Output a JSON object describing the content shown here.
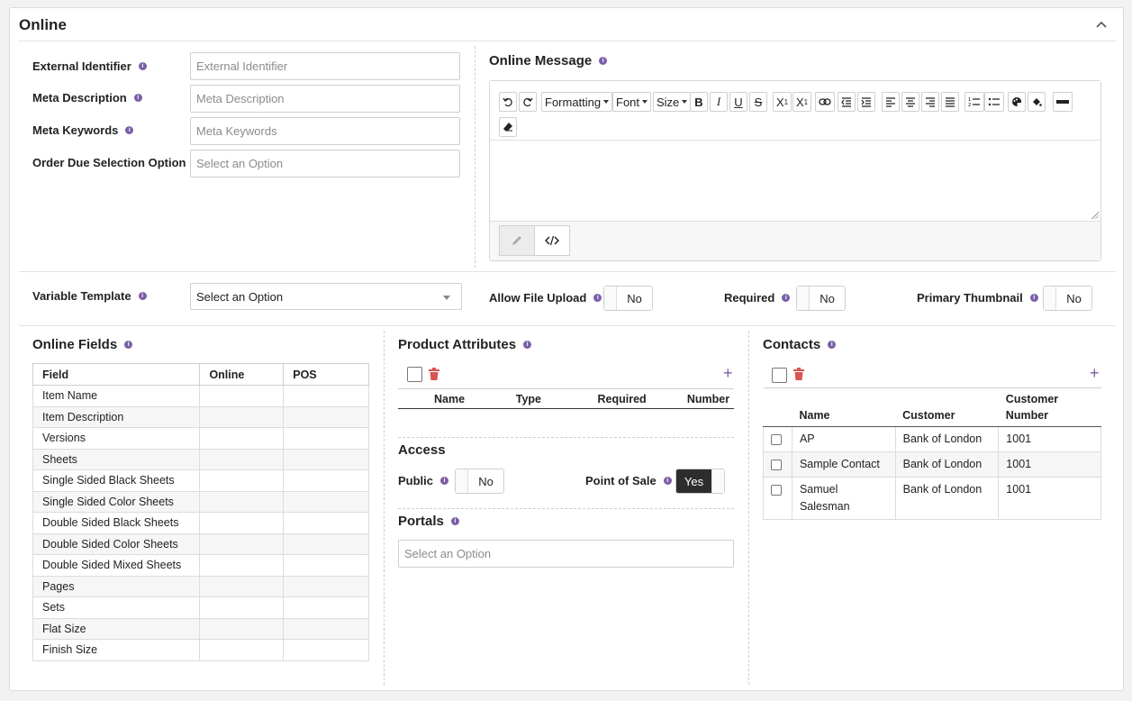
{
  "panel": {
    "title": "Online"
  },
  "general": {
    "external_identifier": {
      "label": "External Identifier",
      "placeholder": "External Identifier"
    },
    "meta_description": {
      "label": "Meta Description",
      "placeholder": "Meta Description"
    },
    "meta_keywords": {
      "label": "Meta Keywords",
      "placeholder": "Meta Keywords"
    },
    "order_due": {
      "label": "Order Due Selection Option",
      "placeholder": "Select an Option"
    }
  },
  "online_message": {
    "label": "Online Message",
    "toolbar": {
      "formatting": "Formatting",
      "font": "Font",
      "size": "Size"
    }
  },
  "options_row": {
    "variable_template": {
      "label": "Variable Template",
      "value": "Select an Option"
    },
    "allow_file_upload": {
      "label": "Allow File Upload",
      "value": "No"
    },
    "required": {
      "label": "Required",
      "value": "No"
    },
    "primary_thumbnail": {
      "label": "Primary Thumbnail",
      "value": "No"
    }
  },
  "online_fields": {
    "title": "Online Fields",
    "columns": [
      "Field",
      "Online",
      "POS"
    ],
    "rows": [
      "Item Name",
      "Item Description",
      "Versions",
      "Sheets",
      "Single Sided Black Sheets",
      "Single Sided Color Sheets",
      "Double Sided Black Sheets",
      "Double Sided Color Sheets",
      "Double Sided Mixed Sheets",
      "Pages",
      "Sets",
      "Flat Size",
      "Finish Size"
    ]
  },
  "product_attributes": {
    "title": "Product Attributes",
    "columns": [
      "Name",
      "Type",
      "Required",
      "Number"
    ]
  },
  "access": {
    "title": "Access",
    "public": {
      "label": "Public",
      "value": "No"
    },
    "point_of_sale": {
      "label": "Point of Sale",
      "value": "Yes"
    }
  },
  "portals": {
    "title": "Portals",
    "placeholder": "Select an Option"
  },
  "contacts": {
    "title": "Contacts",
    "columns": [
      "Name",
      "Customer",
      "Customer Number"
    ],
    "rows": [
      {
        "name": "AP",
        "customer": "Bank of London",
        "number": "1001"
      },
      {
        "name": "Sample Contact",
        "customer": "Bank of London",
        "number": "1001"
      },
      {
        "name": "Samuel Salesman",
        "customer": "Bank of London",
        "number": "1001"
      }
    ]
  },
  "colors": {
    "accent": "#7b5ea7",
    "danger": "#d9534f",
    "active_toggle": "#2d2d2d"
  }
}
